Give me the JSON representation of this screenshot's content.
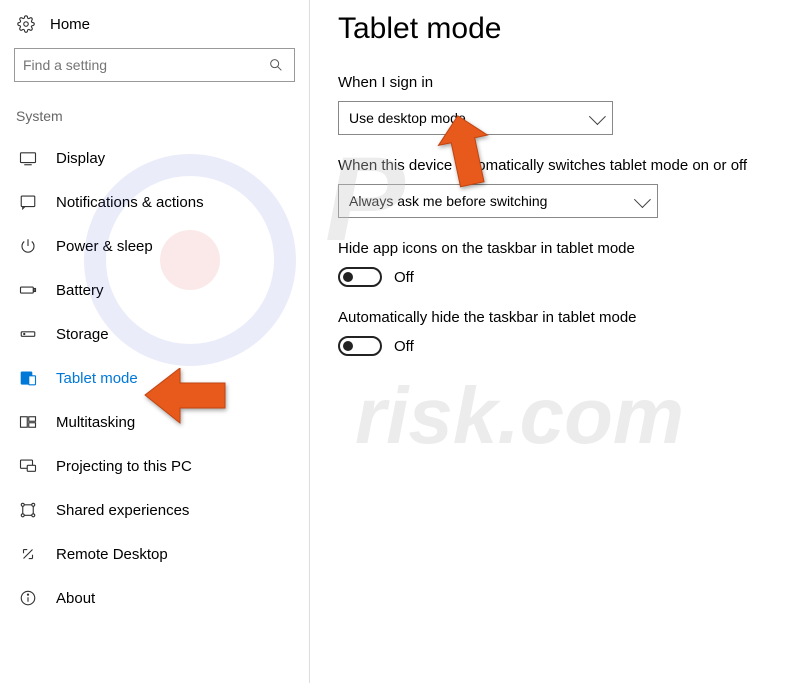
{
  "home_label": "Home",
  "search": {
    "placeholder": "Find a setting"
  },
  "category_header": "System",
  "sidebar": {
    "items": [
      {
        "label": "Display"
      },
      {
        "label": "Notifications & actions"
      },
      {
        "label": "Power & sleep"
      },
      {
        "label": "Battery"
      },
      {
        "label": "Storage"
      },
      {
        "label": "Tablet mode"
      },
      {
        "label": "Multitasking"
      },
      {
        "label": "Projecting to this PC"
      },
      {
        "label": "Shared experiences"
      },
      {
        "label": "Remote Desktop"
      },
      {
        "label": "About"
      }
    ]
  },
  "page_title": "Tablet mode",
  "settings": {
    "signin": {
      "label": "When I sign in",
      "value": "Use desktop mode"
    },
    "autoswitch": {
      "label": "When this device automatically switches tablet mode on or off",
      "value": "Always ask me before switching"
    },
    "hide_icons": {
      "label": "Hide app icons on the taskbar in tablet mode",
      "state": "Off"
    },
    "hide_taskbar": {
      "label": "Automatically hide the taskbar in tablet mode",
      "state": "Off"
    }
  },
  "watermark": {
    "part1": "P",
    "part2": "risk.com"
  }
}
